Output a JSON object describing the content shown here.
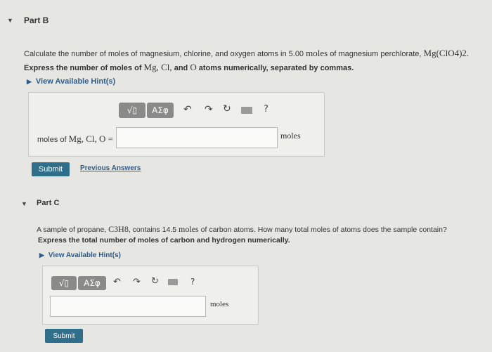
{
  "partB": {
    "title": "Part B",
    "question_prefix": "Calculate the number of moles of magnesium, chlorine, and oxygen atoms in 5.00",
    "question_unit": "moles",
    "question_mid": "of magnesium perchlorate,",
    "question_formula": "Mg(ClO4)2.",
    "instr_prefix": "Express the number of moles of",
    "instr_symbols": "Mg, Cl,",
    "instr_and": "and",
    "instr_o": "O",
    "instr_suffix": "atoms numerically, separated by commas.",
    "hint": "View Available Hint(s)",
    "toolbar": {
      "sqrt": "√▯",
      "greek": "ΑΣφ",
      "help": "?"
    },
    "answer_label_prefix": "moles of",
    "answer_label_symbols": "Mg, Cl, O =",
    "answer_value": "",
    "answer_unit": "moles",
    "submit": "Submit",
    "previous": "Previous Answers"
  },
  "partC": {
    "title": "Part C",
    "question_prefix": "A sample of propane,",
    "question_formula": "C3H8",
    "question_mid": ", contains 14.5",
    "question_unit": "moles",
    "question_suffix": "of carbon atoms. How many total moles of atoms does the sample contain?",
    "instr": "Express the total number of moles of carbon and hydrogen numerically.",
    "hint": "View Available Hint(s)",
    "toolbar": {
      "sqrt": "√▯",
      "greek": "ΑΣφ",
      "help": "?"
    },
    "answer_value": "",
    "answer_unit": "moles",
    "submit": "Submit"
  }
}
